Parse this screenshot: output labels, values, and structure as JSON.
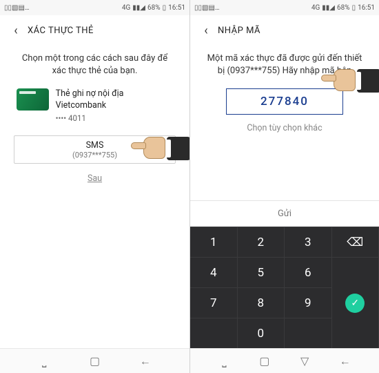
{
  "status": {
    "net": "4G",
    "battery": "68%",
    "time": "16:51"
  },
  "left": {
    "title": "XÁC THỰC THẺ",
    "instruction": "Chọn một trong các cách sau đây để xác thực thẻ của bạn.",
    "card_name": "Thẻ ghi nợ nội địa Vietcombank",
    "card_mask": "•••• 4011",
    "sms_label": "SMS",
    "sms_number": "(0937***755)",
    "later": "Sau"
  },
  "right": {
    "title": "NHẬP MÃ",
    "instruction": "Một mã xác thực đã được gửi đến thiết bị (0937***755) Hãy nhập mã bên",
    "code": "277840",
    "other": "Chọn tùy chọn khác",
    "send": "Gửi",
    "keys": [
      "1",
      "2",
      "3",
      "4",
      "5",
      "6",
      "7",
      "8",
      "9",
      "0"
    ],
    "backspace": "⌫",
    "done": "✓"
  }
}
